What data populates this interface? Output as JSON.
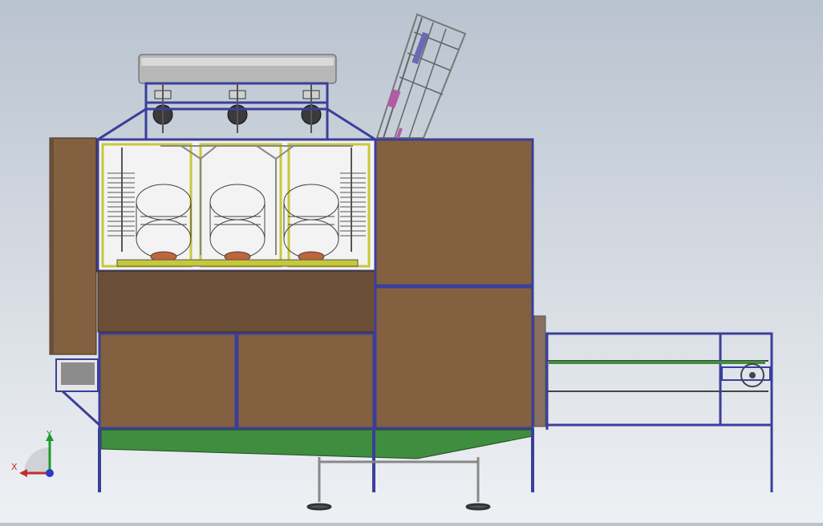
{
  "viewport": {
    "background_top": "#b9c3cf",
    "background_bottom": "#eef1f4"
  },
  "model": {
    "panel_color": "#83603f",
    "panel_dark_color": "#6b4e36",
    "frame_color": "#3a3f9a",
    "tray_color": "#3f8d3f",
    "inner_frame_color": "#c7c83a",
    "tank_color": "#b7b7b7"
  },
  "triad": {
    "x_label": "X",
    "y_label": "Y",
    "x_color": "#c0302a",
    "y_color": "#1e9a2a",
    "z_color": "#2a3cc0"
  }
}
